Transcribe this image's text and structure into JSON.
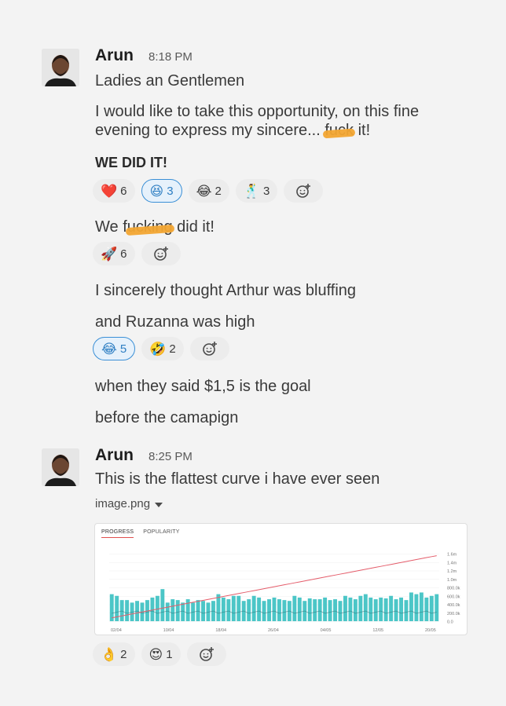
{
  "messages": [
    {
      "author": "Arun",
      "time": "8:18 PM",
      "lines": {
        "l1": "Ladies an Gentlemen",
        "l2": "I would like to take this opportunity, on this fine",
        "l3_pre": "evening to express my sincere... ",
        "l3_censored": "fuck",
        "l3_post": " it!",
        "l4": "WE DID IT!",
        "l5_pre": "We f",
        "l5_censored": "ucking",
        "l5_post": " did it!",
        "l6": "I sincerely thought Arthur was bluffing",
        "l7": "and Ruzanna was high",
        "l8": "when they said $1,5 is the goal",
        "l9": "before the camapign"
      },
      "reactions_1": [
        {
          "emoji": "❤️",
          "count": "6",
          "active": false
        },
        {
          "emoji": "😆",
          "count": "3",
          "active": true
        },
        {
          "emoji": "😂",
          "count": "2",
          "active": false
        },
        {
          "emoji": "🕺",
          "count": "3",
          "active": false
        }
      ],
      "reactions_2": [
        {
          "emoji": "🚀",
          "count": "6",
          "active": false
        }
      ],
      "reactions_3": [
        {
          "emoji": "😂",
          "count": "5",
          "active": true
        },
        {
          "emoji": "🤣",
          "count": "2",
          "active": false
        }
      ]
    },
    {
      "author": "Arun",
      "time": "8:25 PM",
      "text": "This is the flattest curve i have ever seen",
      "attachment_name": "image.png",
      "reactions": [
        {
          "emoji": "👌",
          "count": "2",
          "active": false
        },
        {
          "emoji": "😍",
          "count": "1",
          "active": false
        }
      ]
    }
  ],
  "chart_tabs": {
    "progress": "PROGRESS",
    "popularity": "POPULARITY"
  },
  "chart_data": {
    "type": "bar",
    "title": "",
    "x_ticks": [
      "02/04",
      "10/04",
      "18/04",
      "26/04",
      "04/05",
      "12/05",
      "20/05"
    ],
    "y_ticks_right": [
      "1.6m",
      "1.4m",
      "1.2m",
      "1.0m",
      "800.0k",
      "600.0k",
      "400.0k",
      "200.0k",
      "0.0"
    ],
    "ylim": [
      0,
      1600000
    ],
    "bar_series": [
      32,
      30,
      25,
      25,
      22,
      24,
      22,
      25,
      28,
      30,
      38,
      22,
      26,
      25,
      22,
      26,
      22,
      25,
      24,
      22,
      24,
      32,
      28,
      26,
      30,
      30,
      24,
      26,
      30,
      28,
      24,
      26,
      28,
      26,
      25,
      24,
      30,
      28,
      24,
      27,
      26,
      26,
      28,
      25,
      26,
      24,
      30,
      28,
      26,
      30,
      32,
      28,
      26,
      28,
      27,
      30,
      26,
      28,
      25,
      34,
      32,
      34,
      28,
      30,
      32
    ],
    "cumulative_line": [
      0.05,
      0.97
    ],
    "colors": {
      "bar": "#4cc6c7",
      "line": "#e45c6a",
      "tab_underline": "#e0504e",
      "active_reaction": "#3a8fd6"
    }
  }
}
